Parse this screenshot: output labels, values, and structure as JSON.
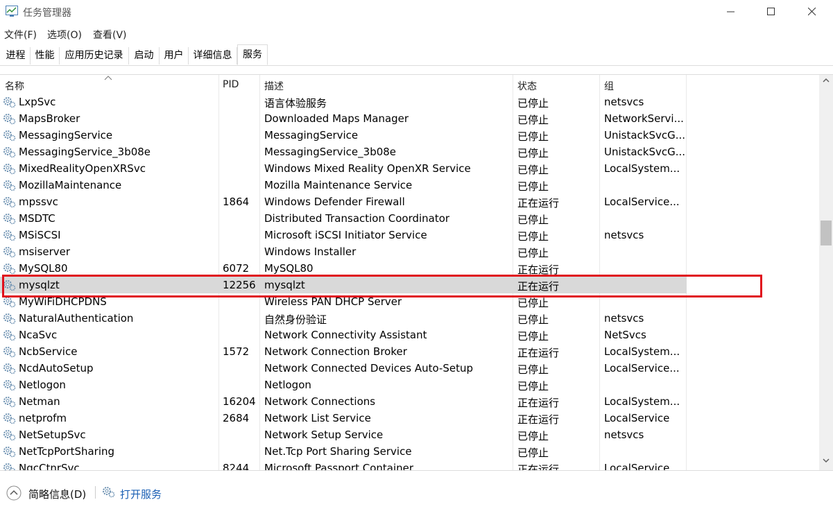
{
  "window": {
    "title": "任务管理器",
    "app_icon": "task-manager-icon",
    "controls": [
      "minimize-icon",
      "maximize-icon",
      "close-icon"
    ]
  },
  "menu": [
    "文件(F)",
    "选项(O)",
    "查看(V)"
  ],
  "tabs": [
    "进程",
    "性能",
    "应用历史记录",
    "启动",
    "用户",
    "详细信息",
    "服务"
  ],
  "active_tab": "服务",
  "table": {
    "headers": {
      "name": "名称",
      "pid": "PID",
      "desc": "描述",
      "status": "状态",
      "group": "组"
    },
    "sort_column": "名称",
    "rows": [
      {
        "name": "LxpSvc",
        "pid": "",
        "desc": "语言体验服务",
        "status": "已停止",
        "group": "netsvcs"
      },
      {
        "name": "MapsBroker",
        "pid": "",
        "desc": "Downloaded Maps Manager",
        "status": "已停止",
        "group": "NetworkServi..."
      },
      {
        "name": "MessagingService",
        "pid": "",
        "desc": "MessagingService",
        "status": "已停止",
        "group": "UnistackSvcG..."
      },
      {
        "name": "MessagingService_3b08e",
        "pid": "",
        "desc": "MessagingService_3b08e",
        "status": "已停止",
        "group": "UnistackSvcG..."
      },
      {
        "name": "MixedRealityOpenXRSvc",
        "pid": "",
        "desc": "Windows Mixed Reality OpenXR Service",
        "status": "已停止",
        "group": "LocalSystem..."
      },
      {
        "name": "MozillaMaintenance",
        "pid": "",
        "desc": "Mozilla Maintenance Service",
        "status": "已停止",
        "group": ""
      },
      {
        "name": "mpssvc",
        "pid": "1864",
        "desc": "Windows Defender Firewall",
        "status": "正在运行",
        "group": "LocalService..."
      },
      {
        "name": "MSDTC",
        "pid": "",
        "desc": "Distributed Transaction Coordinator",
        "status": "已停止",
        "group": ""
      },
      {
        "name": "MSiSCSI",
        "pid": "",
        "desc": "Microsoft iSCSI Initiator Service",
        "status": "已停止",
        "group": "netsvcs"
      },
      {
        "name": "msiserver",
        "pid": "",
        "desc": "Windows Installer",
        "status": "已停止",
        "group": ""
      },
      {
        "name": "MySQL80",
        "pid": "6072",
        "desc": "MySQL80",
        "status": "正在运行",
        "group": ""
      },
      {
        "name": "mysqlzt",
        "pid": "12256",
        "desc": "mysqlzt",
        "status": "正在运行",
        "group": ""
      },
      {
        "name": "MyWiFiDHCPDNS",
        "pid": "",
        "desc": "Wireless PAN DHCP Server",
        "status": "已停止",
        "group": ""
      },
      {
        "name": "NaturalAuthentication",
        "pid": "",
        "desc": "自然身份验证",
        "status": "已停止",
        "group": "netsvcs"
      },
      {
        "name": "NcaSvc",
        "pid": "",
        "desc": "Network Connectivity Assistant",
        "status": "已停止",
        "group": "NetSvcs"
      },
      {
        "name": "NcbService",
        "pid": "1572",
        "desc": "Network Connection Broker",
        "status": "正在运行",
        "group": "LocalSystem..."
      },
      {
        "name": "NcdAutoSetup",
        "pid": "",
        "desc": "Network Connected Devices Auto-Setup",
        "status": "已停止",
        "group": "LocalService..."
      },
      {
        "name": "Netlogon",
        "pid": "",
        "desc": "Netlogon",
        "status": "已停止",
        "group": ""
      },
      {
        "name": "Netman",
        "pid": "16204",
        "desc": "Network Connections",
        "status": "正在运行",
        "group": "LocalSystem..."
      },
      {
        "name": "netprofm",
        "pid": "2684",
        "desc": "Network List Service",
        "status": "正在运行",
        "group": "LocalService"
      },
      {
        "name": "NetSetupSvc",
        "pid": "",
        "desc": "Network Setup Service",
        "status": "已停止",
        "group": "netsvcs"
      },
      {
        "name": "NetTcpPortSharing",
        "pid": "",
        "desc": "Net.Tcp Port Sharing Service",
        "status": "已停止",
        "group": ""
      },
      {
        "name": "NgcCtnrSvc",
        "pid": "8244",
        "desc": "Microsoft Passport Container",
        "status": "正在运行",
        "group": "LocalService..."
      }
    ]
  },
  "selected_row": "mysqlzt",
  "highlight_color": "#e0101c",
  "bottom": {
    "summary_label": "简略信息(D)",
    "open_services_label": "打开服务"
  }
}
